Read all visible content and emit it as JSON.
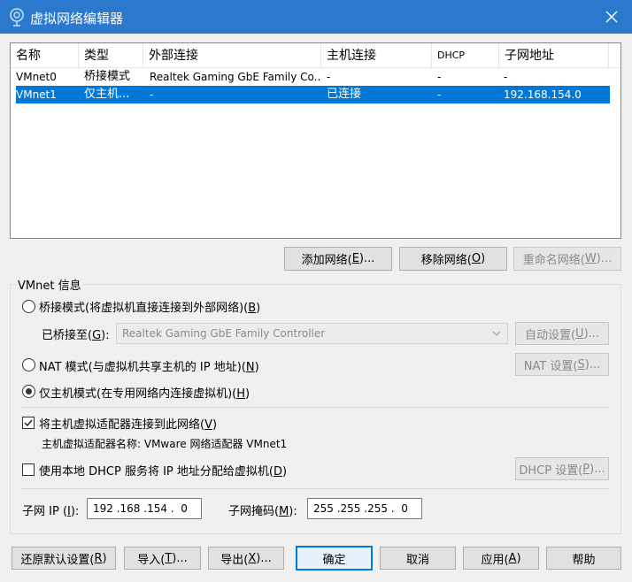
{
  "window": {
    "title": "虚拟网络编辑器"
  },
  "table": {
    "columns": [
      "名称",
      "类型",
      "外部连接",
      "主机连接",
      "DHCP",
      "子网地址"
    ],
    "rows": [
      {
        "name": "VMnet0",
        "type": "桥接模式",
        "external": "Realtek Gaming GbE Family Co...",
        "host": "-",
        "dhcp": "-",
        "subnet": "-"
      },
      {
        "name": "VMnet1",
        "type": "仅主机...",
        "external": "-",
        "host": "已连接",
        "dhcp": "-",
        "subnet": "192.168.154.0"
      }
    ]
  },
  "table_buttons": {
    "add": {
      "label": "添加网络(",
      "key": "E",
      "suffix": ")..."
    },
    "remove": {
      "label": "移除网络(",
      "key": "O",
      "suffix": ")"
    },
    "rename": {
      "label": "重命名网络(",
      "key": "W",
      "suffix": ")..."
    }
  },
  "vmnet_info": {
    "label": "VMnet 信息",
    "bridged": {
      "label": "桥接模式(将虚拟机直接连接到外部网络)(",
      "key": "B",
      "suffix": ")"
    },
    "bridged_to": {
      "label": "已桥接至(",
      "key": "G",
      "suffix": "):",
      "value": "Realtek Gaming GbE Family Controller"
    },
    "auto_settings": {
      "label": "自动设置(",
      "key": "U",
      "suffix": ")..."
    },
    "nat": {
      "label": "NAT 模式(与虚拟机共享主机的 IP 地址)(",
      "key": "N",
      "suffix": ")"
    },
    "nat_settings": {
      "label": "NAT 设置(",
      "key": "S",
      "suffix": ")..."
    },
    "host_only": {
      "label": "仅主机模式(在专用网络内连接虚拟机)(",
      "key": "H",
      "suffix": ")"
    },
    "connect_adapter": {
      "label": "将主机虚拟适配器连接到此网络(",
      "key": "V",
      "suffix": ")"
    },
    "adapter_name": "主机虚拟适配器名称: VMware 网络适配器 VMnet1",
    "use_dhcp": {
      "label": "使用本地 DHCP 服务将 IP 地址分配给虚拟机(",
      "key": "D",
      "suffix": ")"
    },
    "dhcp_settings": {
      "label": "DHCP 设置(",
      "key": "P",
      "suffix": ")..."
    },
    "subnet_ip": {
      "label": "子网 IP (",
      "key": "I",
      "suffix": "):",
      "value": "192 .168 .154 .  0"
    },
    "subnet_mask": {
      "label": "子网掩码(",
      "key": "M",
      "suffix": "):",
      "value": "255 .255 .255 .  0"
    }
  },
  "bottom_buttons": {
    "restore": {
      "label": "还原默认设置(",
      "key": "R",
      "suffix": ")"
    },
    "import": {
      "label": "导入(",
      "key": "T",
      "suffix": ")..."
    },
    "export": {
      "label": "导出(",
      "key": "X",
      "suffix": ")..."
    },
    "ok": {
      "label": "确定"
    },
    "cancel": {
      "label": "取消"
    },
    "apply": {
      "label": "应用(",
      "key": "A",
      "suffix": ")"
    },
    "help": {
      "label": "帮助"
    }
  },
  "state": {
    "selected_row": 1,
    "mode": "host_only",
    "connect_adapter_checked": true,
    "use_dhcp_checked": false
  },
  "colors": {
    "titlebar": "#2b78cd",
    "selection": "#0078d7",
    "default_button_border": "#0078d7"
  }
}
